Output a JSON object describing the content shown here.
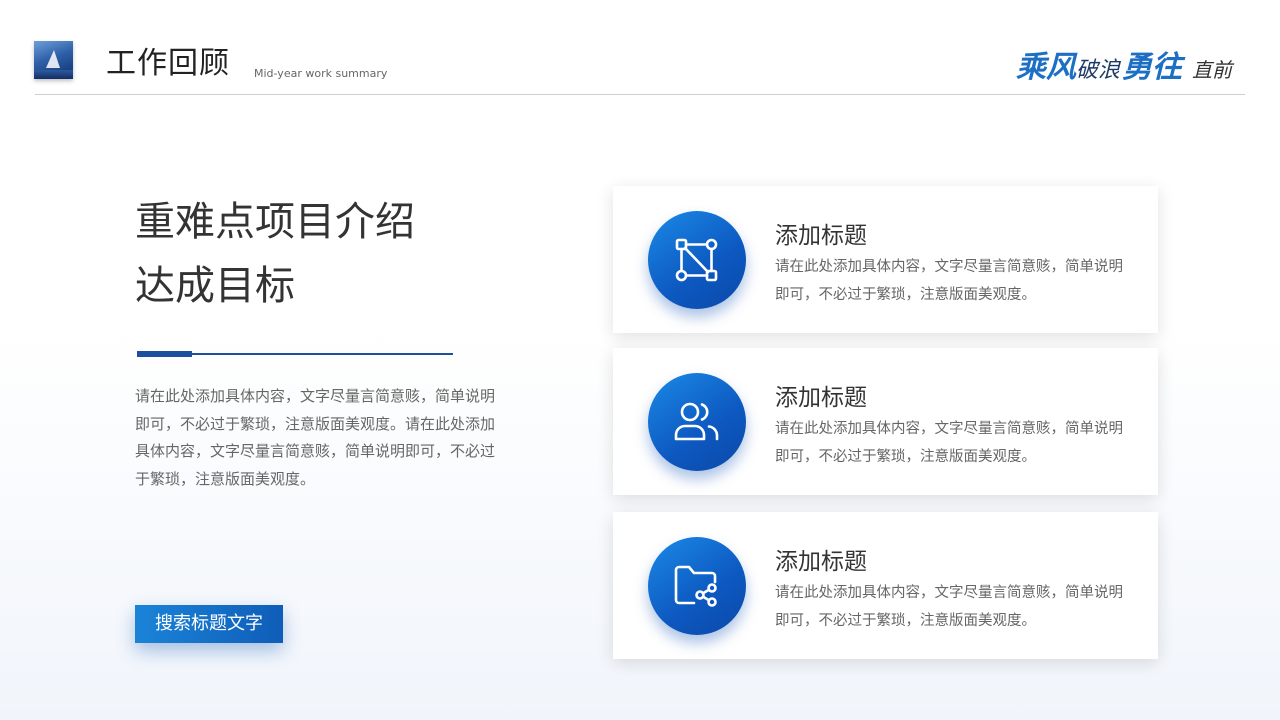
{
  "header": {
    "title": "工作回顾",
    "subtitle": "Mid-year work summary",
    "slogan": {
      "part1": "乘风",
      "part2": "破浪",
      "part3": "勇往",
      "part4": "直前"
    }
  },
  "main": {
    "title_line1": "重难点项目介绍",
    "title_line2": "达成目标",
    "description": "请在此处添加具体内容，文字尽量言简意赅，简单说明即可，不必过于繁琐，注意版面美观度。请在此处添加具体内容，文字尽量言简意赅，简单说明即可，不必过于繁琐，注意版面美观度。",
    "button_label": "搜索标题文字"
  },
  "cards": [
    {
      "icon": "connection-diagram-icon",
      "title": "添加标题",
      "text": "请在此处添加具体内容，文字尽量言简意赅，简单说明即可，不必过于繁琐，注意版面美观度。"
    },
    {
      "icon": "users-icon",
      "title": "添加标题",
      "text": "请在此处添加具体内容，文字尽量言简意赅，简单说明即可，不必过于繁琐，注意版面美观度。"
    },
    {
      "icon": "folder-share-icon",
      "title": "添加标题",
      "text": "请在此处添加具体内容，文字尽量言简意赅，简单说明即可，不必过于繁琐，注意版面美观度。"
    }
  ],
  "colors": {
    "accent": "#1d6fc4",
    "dark_blue": "#1c4f9c",
    "text": "#333333",
    "muted": "#666666"
  }
}
